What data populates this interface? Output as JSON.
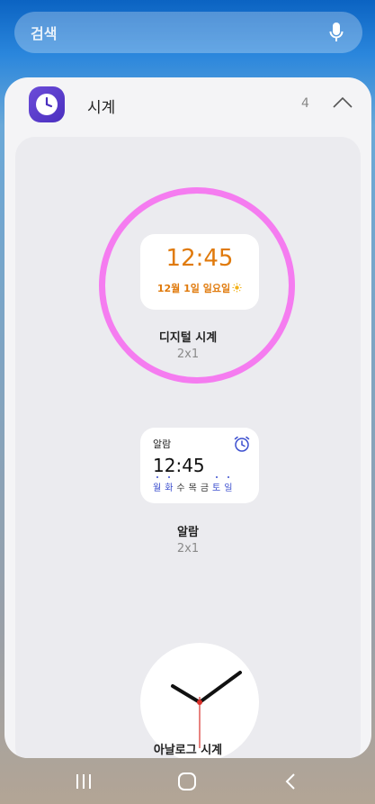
{
  "search": {
    "placeholder": "검색"
  },
  "app": {
    "title": "시계",
    "widget_count": "4"
  },
  "widgets": [
    {
      "name": "디지털 시계",
      "size": "2x1",
      "time": "12:45",
      "date": "12월 1일 일요일",
      "selected": true
    },
    {
      "name": "알람",
      "size": "2x1",
      "label": "알람",
      "time": "12:45",
      "days": [
        {
          "label": "월",
          "active": true
        },
        {
          "label": "화",
          "active": true
        },
        {
          "label": "수",
          "active": false
        },
        {
          "label": "목",
          "active": false
        },
        {
          "label": "금",
          "active": false
        },
        {
          "label": "토",
          "active": true
        },
        {
          "label": "일",
          "active": true
        }
      ]
    },
    {
      "name": "아날로그 시계"
    }
  ],
  "colors": {
    "digital_accent": "#e07a0c",
    "alarm_accent": "#3c4fcf",
    "selection_ring": "#f57cf0",
    "app_icon": "#5a3bd0",
    "second_hand": "#d9302a"
  },
  "icons": {
    "mic": "mic-icon",
    "app": "clock-app-icon",
    "collapse": "chevron-up-icon",
    "weather": "sun-icon",
    "alarm": "alarm-clock-icon",
    "nav_recents": "recents-icon",
    "nav_home": "home-icon",
    "nav_back": "back-icon"
  }
}
